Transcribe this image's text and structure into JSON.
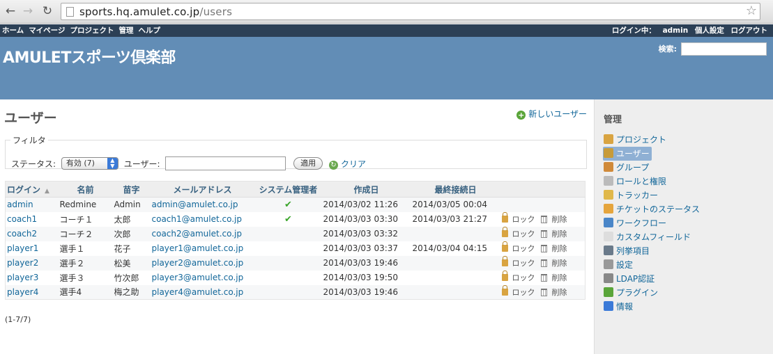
{
  "browser": {
    "url_host": "sports.hq.amulet.co.jp",
    "url_path": "/users"
  },
  "top_menu": {
    "left": [
      "ホーム",
      "マイページ",
      "プロジェクト",
      "管理",
      "ヘルプ"
    ],
    "logged_in_label": "ログイン中：",
    "logged_in_user": "admin",
    "my_account": "個人設定",
    "logout": "ログアウト"
  },
  "header": {
    "title": "AMULETスポーツ倶楽部",
    "search_label": "検索:"
  },
  "page": {
    "title": "ユーザー",
    "new_user": "新しいユーザー"
  },
  "filters": {
    "legend": "フィルタ",
    "status_label": "ステータス:",
    "status_value": "有効 (7)",
    "user_label": "ユーザー:",
    "apply": "適用",
    "clear": "クリア"
  },
  "table": {
    "headers": [
      "ログイン",
      "名前",
      "苗字",
      "メールアドレス",
      "システム管理者",
      "作成日",
      "最終接続日"
    ],
    "lock_label": "ロック",
    "delete_label": "削除",
    "rows": [
      {
        "login": "admin",
        "firstname": "Redmine",
        "lastname": "Admin",
        "email": "admin@amulet.co.jp",
        "admin": true,
        "created": "2014/03/02 11:26",
        "last_login": "2014/03/05 00:04",
        "actions": false
      },
      {
        "login": "coach1",
        "firstname": "コーチ１",
        "lastname": "太郎",
        "email": "coach1@amulet.co.jp",
        "admin": true,
        "created": "2014/03/03 03:30",
        "last_login": "2014/03/03 21:27",
        "actions": true
      },
      {
        "login": "coach2",
        "firstname": "コーチ２",
        "lastname": "次郎",
        "email": "coach2@amulet.co.jp",
        "admin": false,
        "created": "2014/03/03 03:32",
        "last_login": "",
        "actions": true
      },
      {
        "login": "player1",
        "firstname": "選手１",
        "lastname": "花子",
        "email": "player1@amulet.co.jp",
        "admin": false,
        "created": "2014/03/03 03:37",
        "last_login": "2014/03/04 04:15",
        "actions": true
      },
      {
        "login": "player2",
        "firstname": "選手２",
        "lastname": "松美",
        "email": "player2@amulet.co.jp",
        "admin": false,
        "created": "2014/03/03 19:46",
        "last_login": "",
        "actions": true
      },
      {
        "login": "player3",
        "firstname": "選手３",
        "lastname": "竹次郎",
        "email": "player3@amulet.co.jp",
        "admin": false,
        "created": "2014/03/03 19:50",
        "last_login": "",
        "actions": true
      },
      {
        "login": "player4",
        "firstname": "選手4",
        "lastname": "梅之助",
        "email": "player4@amulet.co.jp",
        "admin": false,
        "created": "2014/03/03 19:46",
        "last_login": "",
        "actions": true
      }
    ]
  },
  "pagination": "(1-7/7)",
  "sidebar": {
    "title": "管理",
    "items": [
      {
        "label": "プロジェクト",
        "icon": "projects-icon",
        "color": "#d9a441",
        "selected": false
      },
      {
        "label": "ユーザー",
        "icon": "user-icon",
        "color": "#c79b3a",
        "selected": true
      },
      {
        "label": "グループ",
        "icon": "group-icon",
        "color": "#d08a3a",
        "selected": false
      },
      {
        "label": "ロールと権限",
        "icon": "roles-icon",
        "color": "#bbbbbb",
        "selected": false
      },
      {
        "label": "トラッカー",
        "icon": "tracker-icon",
        "color": "#e0b84a",
        "selected": false
      },
      {
        "label": "チケットのステータス",
        "icon": "issue-status-icon",
        "color": "#e5a53d",
        "selected": false
      },
      {
        "label": "ワークフロー",
        "icon": "workflow-icon",
        "color": "#4a86c8",
        "selected": false
      },
      {
        "label": "カスタムフィールド",
        "icon": "custom-fields-icon",
        "color": "#dddddd",
        "selected": false
      },
      {
        "label": "列挙項目",
        "icon": "enumerations-icon",
        "color": "#6a7a8a",
        "selected": false
      },
      {
        "label": "設定",
        "icon": "settings-icon",
        "color": "#999999",
        "selected": false
      },
      {
        "label": "LDAP認証",
        "icon": "ldap-icon",
        "color": "#888888",
        "selected": false
      },
      {
        "label": "プラグイン",
        "icon": "plugins-icon",
        "color": "#5aa53a",
        "selected": false
      },
      {
        "label": "情報",
        "icon": "info-icon",
        "color": "#3b7ad8",
        "selected": false
      }
    ]
  }
}
